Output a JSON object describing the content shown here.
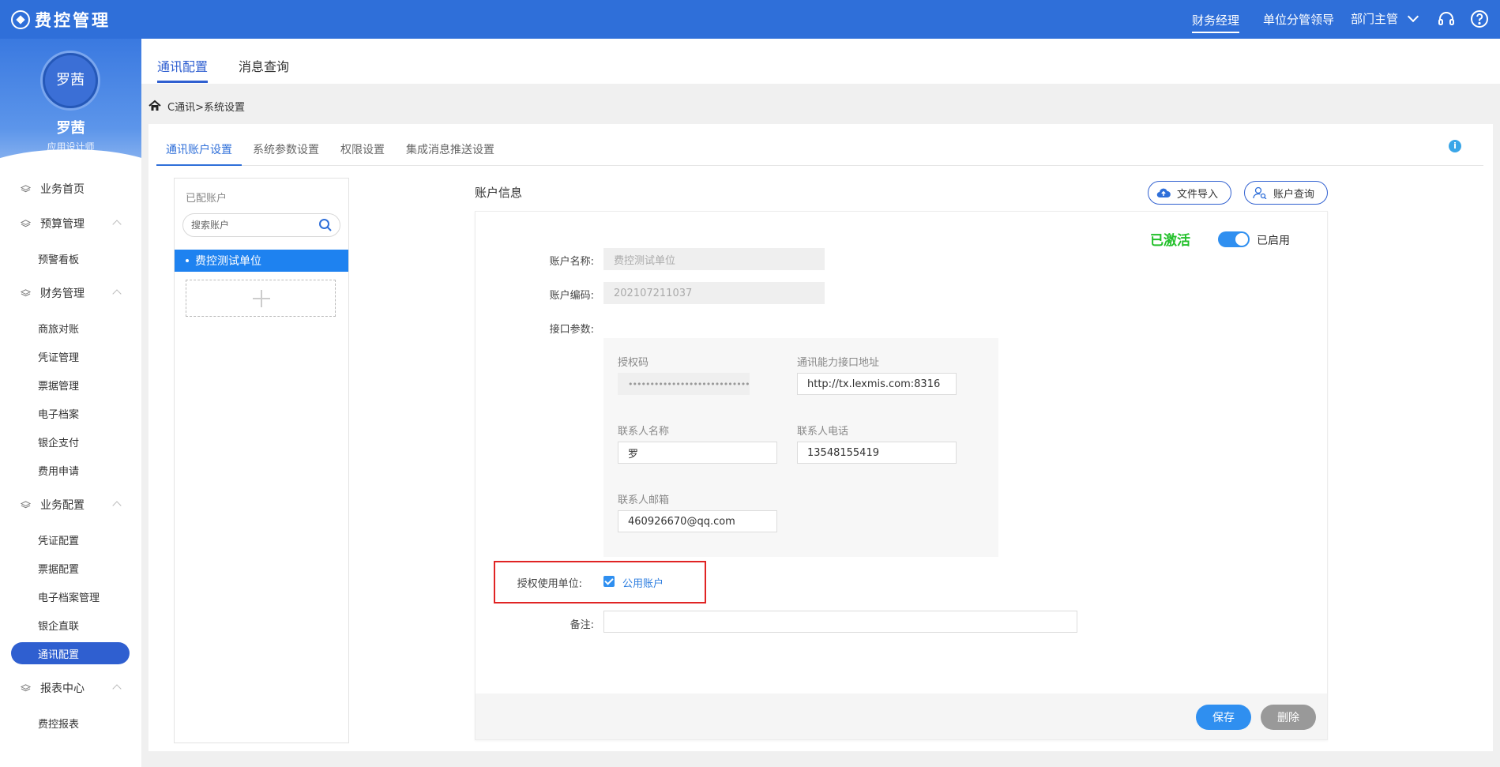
{
  "app": {
    "title": "费控管理"
  },
  "header": {
    "roles": [
      "财务经理",
      "单位分管领导"
    ],
    "role_dropdown": "部门主管",
    "icons": [
      "headset-icon",
      "help-icon"
    ]
  },
  "user": {
    "avatar_text": "罗茜",
    "name": "罗茜",
    "role": "应用设计师"
  },
  "sidebar": {
    "items": [
      {
        "label": "业务首页",
        "type": "group"
      },
      {
        "label": "预算管理",
        "type": "group",
        "expanded": true
      },
      {
        "label": "预警看板",
        "type": "sub"
      },
      {
        "label": "财务管理",
        "type": "group",
        "expanded": true
      },
      {
        "label": "商旅对账",
        "type": "sub"
      },
      {
        "label": "凭证管理",
        "type": "sub"
      },
      {
        "label": "票据管理",
        "type": "sub"
      },
      {
        "label": "电子档案",
        "type": "sub"
      },
      {
        "label": "银企支付",
        "type": "sub"
      },
      {
        "label": "费用申请",
        "type": "sub"
      },
      {
        "label": "业务配置",
        "type": "group",
        "expanded": true
      },
      {
        "label": "凭证配置",
        "type": "sub"
      },
      {
        "label": "票据配置",
        "type": "sub"
      },
      {
        "label": "电子档案管理",
        "type": "sub"
      },
      {
        "label": "银企直联",
        "type": "sub"
      },
      {
        "label": "通讯配置",
        "type": "sub",
        "active": true
      },
      {
        "label": "报表中心",
        "type": "group",
        "expanded": true
      },
      {
        "label": "费控报表",
        "type": "sub"
      }
    ]
  },
  "main": {
    "tabs": [
      {
        "label": "通讯配置",
        "active": true
      },
      {
        "label": "消息查询"
      }
    ],
    "breadcrumb": "C通讯>系统设置",
    "sub_tabs": [
      {
        "label": "通讯账户设置",
        "active": true
      },
      {
        "label": "系统参数设置"
      },
      {
        "label": "权限设置"
      },
      {
        "label": "集成消息推送设置"
      }
    ],
    "info_icon": "i"
  },
  "accounts": {
    "title": "已配账户",
    "search_placeholder": "搜索账户",
    "items": [
      "费控测试单位"
    ]
  },
  "account_info": {
    "title": "账户信息",
    "import_button": "文件导入",
    "query_button": "账户查询",
    "status": "已激活",
    "switch_label": "已启用",
    "name_label": "账户名称:",
    "name_value": "费控测试单位",
    "code_label": "账户编码:",
    "code_value": "202107211037",
    "params_label": "接口参数:",
    "params": {
      "auth_code_label": "授权码",
      "auth_code_value": "•••••••••••••••••••••••••••••••••••",
      "api_url_label": "通讯能力接口地址",
      "api_url_value": "http://tx.lexmis.com:8316",
      "contact_name_label": "联系人名称",
      "contact_name_value": "罗",
      "contact_phone_label": "联系人电话",
      "contact_phone_value": "13548155419",
      "contact_email_label": "联系人邮箱",
      "contact_email_value": "460926670@qq.com"
    },
    "auth_unit_label": "授权使用单位:",
    "public_account_label": "公用账户",
    "public_account_checked": true,
    "remark_label": "备注:",
    "remark_value": "",
    "save_button": "保存",
    "delete_button": "删除"
  },
  "colors": {
    "primary": "#2f6fd9",
    "selected": "#1e82f0",
    "active_status": "#22c02a",
    "highlight": "#e02424"
  }
}
